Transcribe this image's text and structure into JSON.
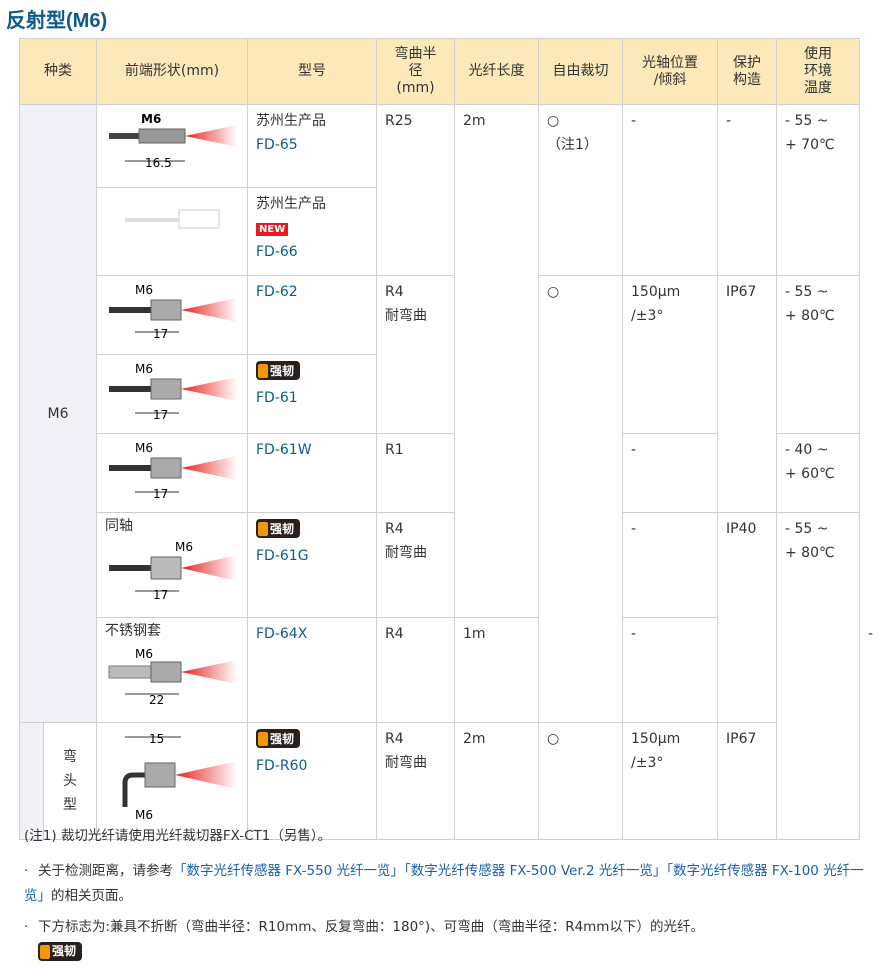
{
  "title": "反射型(M6)",
  "headers": [
    "种类",
    "前端形状(mm)",
    "型号",
    "弯曲半\n径\n(mm)",
    "光纤长度",
    "自由裁切",
    "光轴位置\n/倾斜",
    "保护\n构造",
    "使用\n环境\n温度"
  ],
  "kind": {
    "main": "M6",
    "sub": "弯\n头\n型"
  },
  "pics": {
    "fd65": {
      "m": "M6",
      "dim": "16.5"
    },
    "fd62": {
      "m": "M6",
      "dim": "17"
    },
    "fd61": {
      "m": "M6",
      "dim": "17"
    },
    "fd61w": {
      "m": "M6",
      "dim": "17"
    },
    "fd61g": {
      "label": "同轴",
      "m": "M6",
      "dim": "17"
    },
    "fd64x": {
      "label": "不锈钢套",
      "m": "M6",
      "dim": "22"
    },
    "fdr60": {
      "m": "M6",
      "dim": "15"
    }
  },
  "models": {
    "fd65": {
      "prefix": "苏州生产品",
      "name": "FD-65"
    },
    "fd66": {
      "prefix": "苏州生产品",
      "badge": "NEW",
      "name": "FD-66"
    },
    "fd62": {
      "name": "FD-62"
    },
    "fd61": {
      "badge": "强韧",
      "name": "FD-61"
    },
    "fd61w": {
      "name": "FD-61W"
    },
    "fd61g": {
      "badge": "强韧",
      "name": "FD-61G"
    },
    "fd64x": {
      "name": "FD-64X"
    },
    "fdr60": {
      "badge": "强韧",
      "name": "FD-R60"
    }
  },
  "bend": {
    "r25": "R25",
    "r4a": "R4\n耐弯曲",
    "r1": "R1",
    "r4b": "R4\n耐弯曲",
    "r4c": "R4",
    "r4d": "R4\n耐弯曲"
  },
  "length": {
    "l2m": "2m",
    "l1m": "1m",
    "l2mb": "2m"
  },
  "cut": {
    "c1": "○\n（注1）",
    "c2": "○",
    "c3": "-",
    "c4": "○"
  },
  "axis": {
    "a1": "-",
    "a2": "150μm\n/±3°",
    "a3": "-",
    "a4": "-",
    "a5": "-",
    "a6": "150μm\n/±3°"
  },
  "protect": {
    "p1": "-",
    "p2": "IP67",
    "p3": "IP40",
    "p4": "IP67"
  },
  "temp": {
    "t1": "- 55 ~\n+ 70℃",
    "t2": "- 55 ~\n+ 80℃",
    "t3": "- 40 ~\n+ 60℃",
    "t4": "- 55 ~\n+ 80℃"
  },
  "notes": {
    "n1": "(注1) 裁切光纤请使用光纤裁切器FX-CT1（另售）。",
    "n2_pre": "关于检测距离，请参考",
    "n2_l1": "「数字光纤传感器 FX-550 光纤一览」",
    "n2_l2": "「数字光纤传感器 FX-500 Ver.2 光纤一览」",
    "n2_l3": "「数字光纤传感器 FX-100 光纤一览」",
    "n2_post": "的相关页面。",
    "n3": "下方标志为:兼具不折断（弯曲半径：R10mm、反复弯曲：180°)、可弯曲（弯曲半径：R4mm以下）的光纤。",
    "n3_badge": "强韧",
    "bullet": "·"
  },
  "colors": {
    "header_bg": "#fce9b9",
    "kind_bg": "#eff3f8",
    "title": "#0e5a8a",
    "link": "#1a5fa8",
    "badge_new": "#e41d24"
  }
}
